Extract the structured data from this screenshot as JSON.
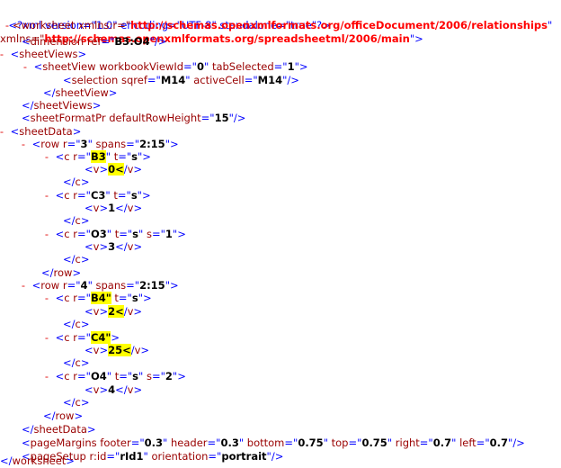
{
  "xml": {
    "decl": "<?xml version=\"1.0\" encoding=\"UTF-8\" standalone=\"true\"?>",
    "worksheet_open_a": "<worksheet xmlns:r=\"",
    "ns_r": "http://schemas.openxmlformats.org/officeDocument/2006/relationships",
    "worksheet_open_b": "\"",
    "xmlns_label": "xmlns=\"",
    "ns_main": "http://schemas.openxmlformats.org/spreadsheetml/2006/main",
    "xmlns_end": "\">",
    "toggle": "-",
    "lines": [
      "<dimension ref=\"B3:O4\"/>",
      "<sheetViews>",
      "<sheetView workbookViewId=\"0\" tabSelected=\"1\">",
      "<selection sqref=\"M14\" activeCell=\"M14\"/>",
      "</sheetView>",
      "</sheetViews>",
      "<sheetFormatPr defaultRowHeight=\"15\"/>",
      "<sheetData>",
      "<row r=\"3\" spans=\"2:15\">",
      "<c r=\"B3\" t=\"s\">",
      "<v>0</v>",
      "</c>",
      "<c r=\"C3\" t=\"s\">",
      "<v>1</v>",
      "</c>",
      "<c r=\"O3\" t=\"s\" s=\"1\">",
      "<v>3</v>",
      "</c>",
      "</row>",
      "<row r=\"4\" spans=\"2:15\">",
      "<c r=\"B4\" t=\"s\">",
      "<v>2</v>",
      "</c>",
      "<c r=\"C4\">",
      "<v>25</v>",
      "</c>",
      "<c r=\"O4\" t=\"s\" s=\"2\">",
      "<v>4</v>",
      "</c>",
      "</row>",
      "</sheetData>",
      "<pageMargins footer=\"0.3\" header=\"0.3\" bottom=\"0.75\" top=\"0.75\" right=\"0.7\" left=\"0.7\"/>",
      "<pageSetup r:id=\"rId1\" orientation=\"portrait\"/>",
      "</worksheet>"
    ]
  }
}
